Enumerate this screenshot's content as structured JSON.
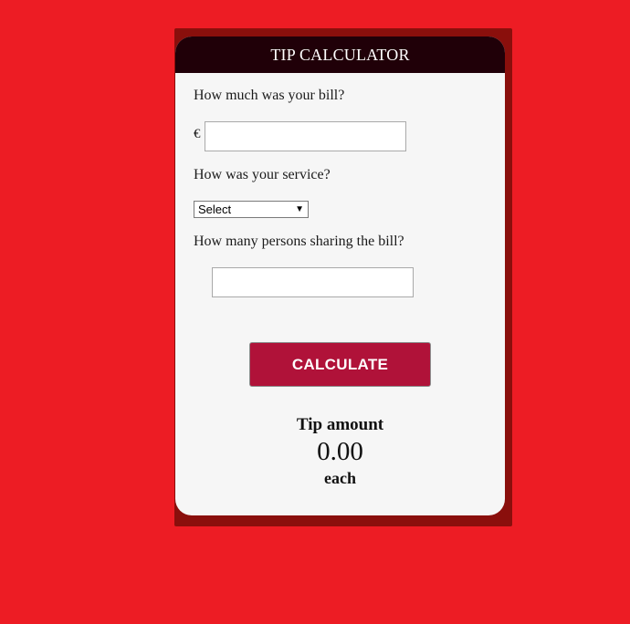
{
  "header": {
    "title": "TIP CALCULATOR"
  },
  "bill": {
    "question": "How much was your bill?",
    "currency_symbol": "€",
    "value": "",
    "placeholder": ""
  },
  "service": {
    "question": "How was your service?",
    "selected": "Select"
  },
  "persons": {
    "question": "How many persons sharing the bill?",
    "value": "",
    "placeholder": ""
  },
  "calculate_button": {
    "label": "CALCULATE"
  },
  "result": {
    "title": "Tip amount",
    "value": "0.00",
    "suffix": "each"
  },
  "colors": {
    "page_background": "#ed1c24",
    "header_background": "#200008",
    "button_background": "#b01239",
    "card_background": "#f6f6f6"
  }
}
